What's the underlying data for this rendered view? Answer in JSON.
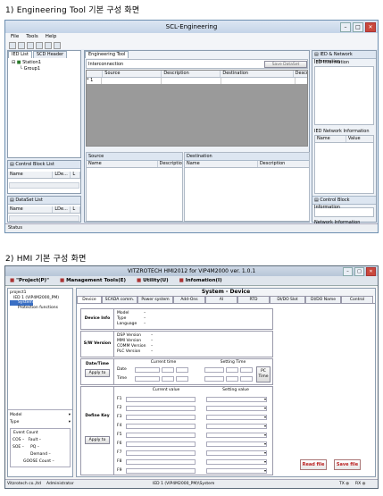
{
  "heading1": "1) Engineering Tool 기본 구성 화면",
  "heading2": "2) HMI 기본 구성 화면",
  "w1": {
    "title": "SCL-Engineering",
    "menu": [
      "File",
      "Tools",
      "Help"
    ],
    "left_tabs": [
      "IED List",
      "SCD Header"
    ],
    "tree": [
      "Station1",
      "Group1"
    ],
    "cb_title": "Control Block List",
    "cb_cols": [
      "Name",
      "LDe...",
      "L"
    ],
    "ds_title": "DataSet List",
    "ds_cols": [
      "Name",
      "LDe...",
      "L"
    ],
    "center_tab": "Engineering Tool",
    "interconnection": "Interconnection",
    "save_dataset": "Save DataSet",
    "ic_cols": [
      "Source",
      "Description",
      "Destination",
      "Descr"
    ],
    "ic_row": "1",
    "source_title": "Source",
    "source_cols": [
      "Name",
      "Descriptio"
    ],
    "dest_title": "Destination",
    "dest_cols": [
      "Name",
      "Description"
    ],
    "right_title": "IED & Network Information",
    "ied_info": "IED Information",
    "ied_net_info": "IED Network Information",
    "net_cols": [
      "Name",
      "Value"
    ],
    "cbi": "Control Block Information",
    "net_info": "Network Information",
    "status": "Status"
  },
  "w2": {
    "title": "VITZROTECH HMI2012 for VIP4M2000 ver. 1.0.1",
    "menu": [
      "\"Project(P)\"",
      "Management Tools(E)",
      "Utility(U)",
      "Infomation(I)"
    ],
    "tree": [
      "project1",
      "IED 1 (VIP4M2000_PM)",
      "System",
      "Protection functions"
    ],
    "left_bottom": {
      "model": "Model",
      "type": "Type",
      "event_count": "Event Count",
      "cos": "COS",
      "fault": "Fault",
      "soe": "SOE",
      "pq": "PQ",
      "demand": "Demand",
      "goose": "GOOSE Count"
    },
    "section_title": "System - Device",
    "tabs": [
      "Device",
      "SCADA comm.",
      "Power system",
      "Add-Ons",
      "AI",
      "RTD",
      "DI/DO Slot",
      "DI/DO Name",
      "Control"
    ],
    "device_info": {
      "label": "Device Info",
      "fields": [
        "Model",
        "Type",
        "Language"
      ]
    },
    "sw_version": {
      "label": "S/W Version",
      "fields": [
        "DSP Version",
        "MMI Version",
        "COMM Version",
        "PLC Version"
      ]
    },
    "datetime": {
      "label": "Date/Time",
      "apply": "Apply to",
      "current": "Current time",
      "setting": "Setting Time",
      "date": "Date",
      "time": "Time",
      "pc_time": "PC Time"
    },
    "define_key": {
      "label": "Define Key",
      "apply": "Apply to",
      "current": "Current value",
      "setting": "Setting value",
      "keys": [
        "F1",
        "F2",
        "F3",
        "F4",
        "F5",
        "F6",
        "F7",
        "F8",
        "F9"
      ]
    },
    "read_file": "Read file",
    "save_file": "Save file",
    "status_left": "Vitzrotech co.,ltd",
    "status_user": "Administrator",
    "status_center": "IED 1 (VIP4M2000_PM)\\System",
    "status_right": [
      "TX",
      "RX"
    ]
  }
}
